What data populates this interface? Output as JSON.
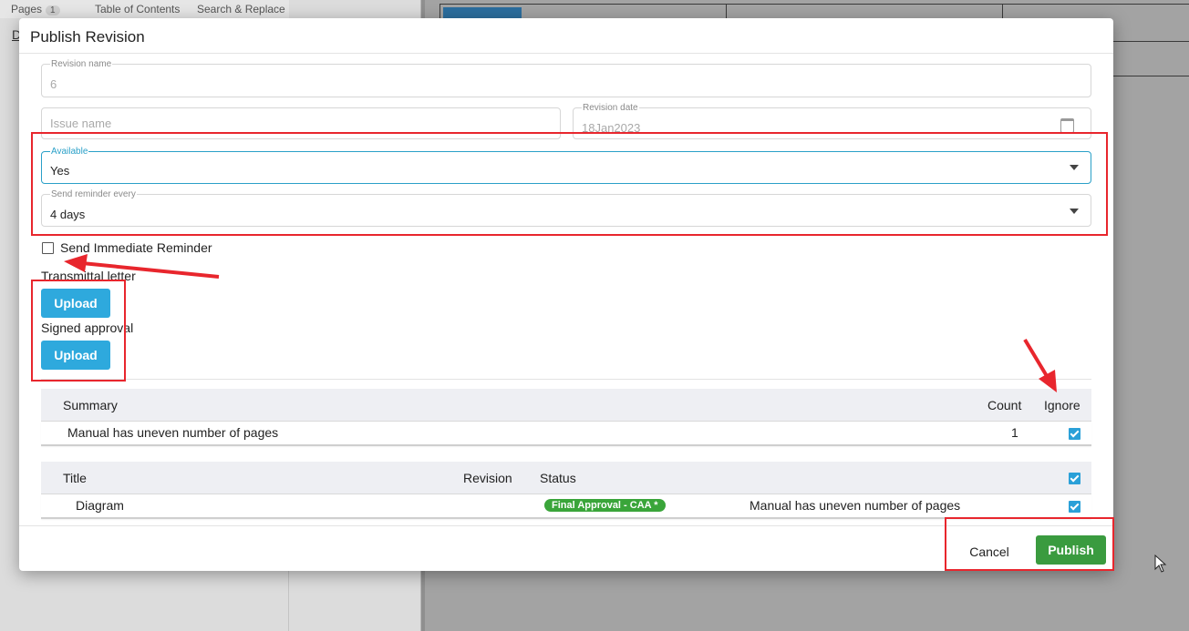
{
  "background": {
    "tabs": [
      {
        "label": "Pages",
        "badge": "1"
      },
      {
        "label": "Table of Contents"
      },
      {
        "label": "Search & Replace"
      }
    ],
    "left_link": "D"
  },
  "modal": {
    "title": "Publish Revision",
    "revision_name": {
      "label": "Revision name",
      "value": "6"
    },
    "issue_name": {
      "placeholder": "Issue name"
    },
    "revision_date": {
      "label": "Revision date",
      "value": "18Jan2023",
      "icon": "calendar-icon"
    },
    "available": {
      "label": "Available",
      "value": "Yes"
    },
    "reminder": {
      "label": "Send reminder every",
      "value": "4 days"
    },
    "immediate_reminder": {
      "label": "Send Immediate Reminder",
      "checked": false
    },
    "transmittal": {
      "label": "Transmittal letter",
      "button": "Upload"
    },
    "signed_approval": {
      "label": "Signed approval",
      "button": "Upload"
    },
    "summary_table": {
      "headers": {
        "summary": "Summary",
        "count": "Count",
        "ignore": "Ignore"
      },
      "rows": [
        {
          "summary": "Manual has uneven number of pages",
          "count": "1",
          "ignore": true
        }
      ]
    },
    "items_table": {
      "headers": {
        "title": "Title",
        "revision": "Revision",
        "status": "Status"
      },
      "header_checked": true,
      "rows": [
        {
          "title": "Diagram",
          "revision": "",
          "status": "Final Approval - CAA *",
          "message": "Manual has uneven number of pages",
          "checked": true
        }
      ]
    },
    "actions": {
      "cancel": "Cancel",
      "publish": "Publish"
    }
  },
  "colors": {
    "accent": "#2ea9dd",
    "publish": "#3a9b3f",
    "status_pill": "#3aa53a",
    "annotation": "#e8262d"
  }
}
